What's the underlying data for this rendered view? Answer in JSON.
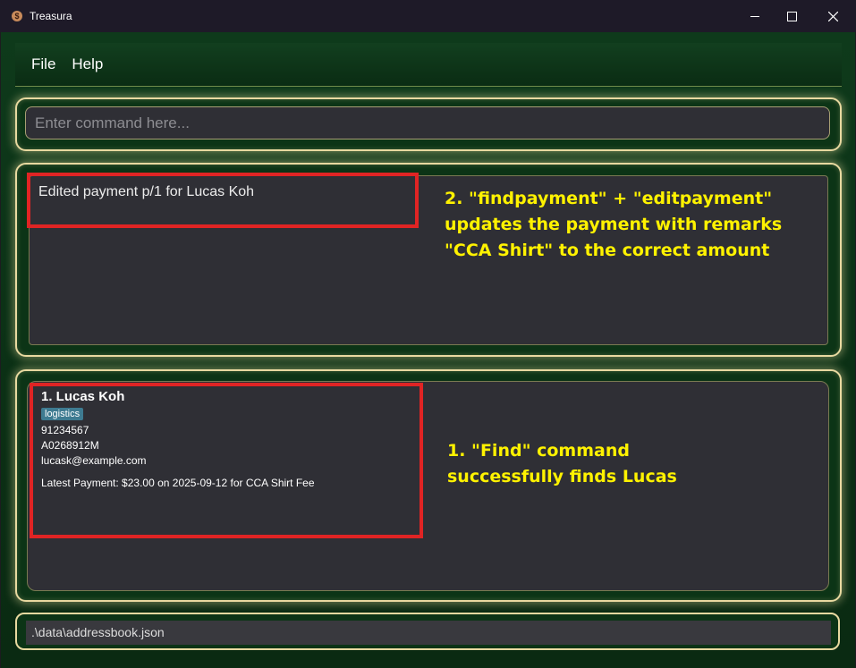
{
  "window": {
    "title": "Treasura",
    "icon": "money-bag-icon"
  },
  "menu": {
    "items": [
      "File",
      "Help"
    ]
  },
  "command": {
    "placeholder": "Enter command here..."
  },
  "result": {
    "message": "Edited payment p/1 for Lucas Koh"
  },
  "person_list": [
    {
      "index_name": "1. Lucas Koh",
      "tags": [
        "logistics"
      ],
      "phone": "91234567",
      "matric": "A0268912M",
      "email": "lucask@example.com",
      "latest_payment": "Latest Payment: $23.00 on 2025-09-12 for CCA Shirt Fee"
    }
  ],
  "status_bar": {
    "file_path": ".\\data\\addressbook.json"
  },
  "annotations": {
    "step2": [
      "2. \"findpayment\" + \"editpayment\"",
      "updates the payment with remarks",
      "\"CCA Shirt\" to the correct amount"
    ],
    "step1": [
      "1. \"Find\" command",
      "successfully finds Lucas"
    ]
  },
  "colors": {
    "background_green": "#0b3015",
    "panel_border": "#e8d9a0",
    "panel_fill": "#2f2f35",
    "highlight_red": "#e02424",
    "annotation_yellow": "#fff200",
    "tag_blue": "#3e7b91"
  }
}
